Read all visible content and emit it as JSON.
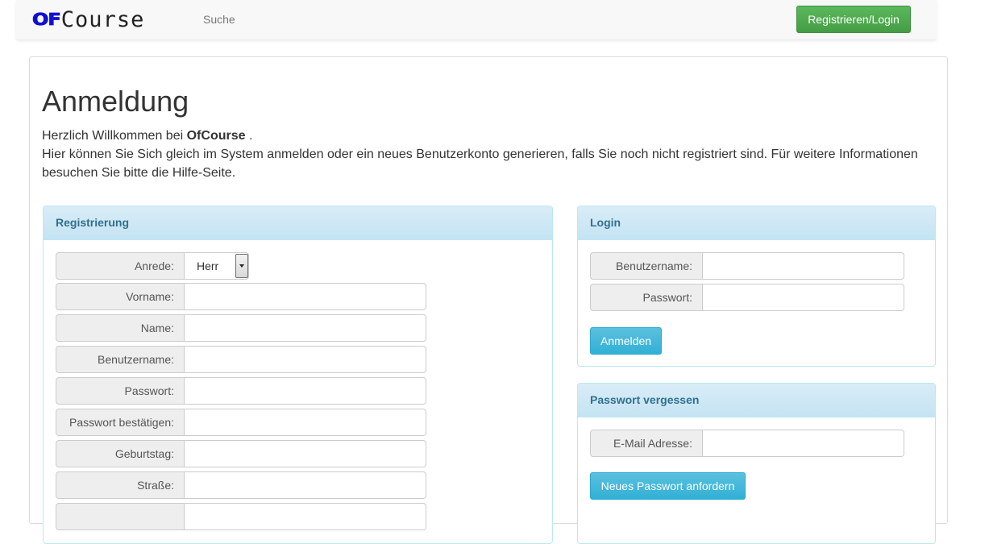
{
  "navbar": {
    "brand_mark": "OF",
    "brand_text": "Course",
    "search_link": "Suche",
    "register_login_button": "Registrieren/Login",
    "colors": {
      "brand_mark": "#1010d0",
      "button": "#5cb85c"
    }
  },
  "page": {
    "title": "Anmeldung",
    "intro_prefix": "Herzlich Willkommen bei",
    "intro_brand": "OfCourse",
    "intro_suffix": ".",
    "intro_text": "Hier können Sie Sich gleich im System anmelden oder ein neues Benutzerkonto generieren, falls Sie noch nicht registriert sind. Für weitere Informationen besuchen Sie bitte die Hilfe-Seite."
  },
  "registration": {
    "heading": "Registrierung",
    "anrede_label": "Anrede:",
    "anrede_value": "Herr",
    "fields": [
      {
        "label": "Vorname:",
        "value": ""
      },
      {
        "label": "Name:",
        "value": ""
      },
      {
        "label": "Benutzername:",
        "value": ""
      },
      {
        "label": "Passwort:",
        "value": ""
      },
      {
        "label": "Passwort bestätigen:",
        "value": ""
      },
      {
        "label": "Geburtstag:",
        "value": ""
      },
      {
        "label": "Straße:",
        "value": ""
      }
    ]
  },
  "login": {
    "heading": "Login",
    "username_label": "Benutzername:",
    "password_label": "Passwort:",
    "submit_label": "Anmelden"
  },
  "password_reset": {
    "heading": "Passwort vergessen",
    "email_label": "E-Mail Adresse:",
    "submit_label": "Neues Passwort anfordern"
  },
  "colors": {
    "panel_heading_text": "#31708f",
    "panel_border": "#bce8f1",
    "info_button": "#5bc0de"
  }
}
